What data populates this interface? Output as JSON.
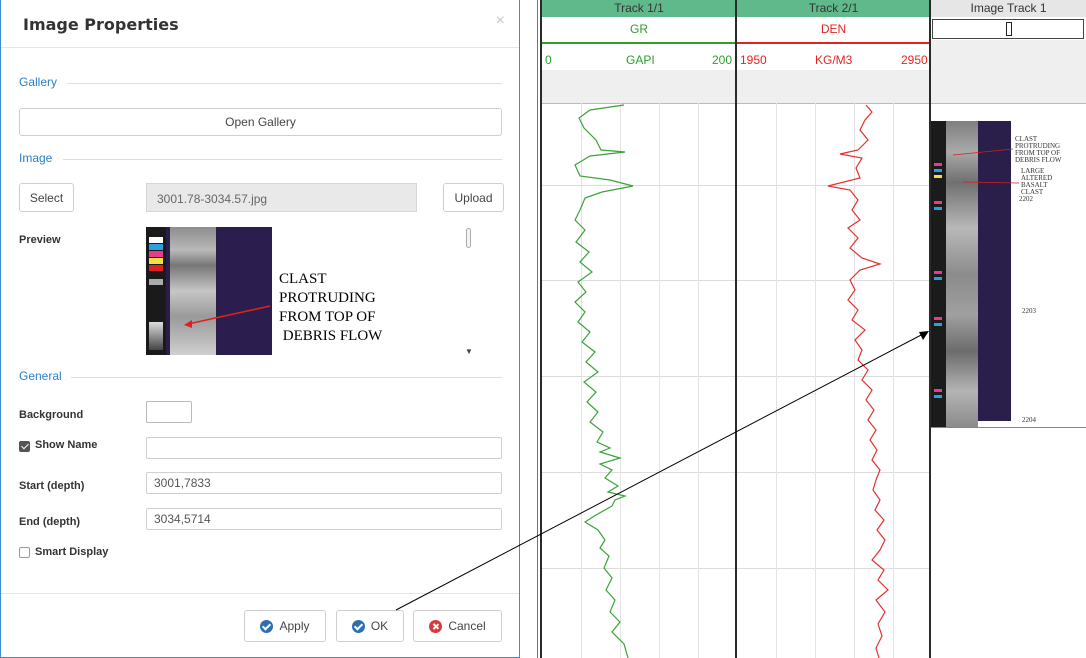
{
  "dialog": {
    "title": "Image Properties",
    "close_glyph": "×",
    "sections": {
      "gallery": "Gallery",
      "image": "Image",
      "general": "General"
    },
    "open_gallery_label": "Open Gallery",
    "select_label": "Select",
    "file_name": "3001.78-3034.57.jpg",
    "upload_label": "Upload",
    "preview_label": "Preview",
    "preview_caption": "CLAST\nPROTRUDING\nFROM TOP OF\n DEBRIS FLOW",
    "fields": {
      "background_label": "Background",
      "background_color": "#ffffff",
      "show_name_label": "Show Name",
      "show_name_checked": true,
      "show_name_value": "",
      "start_label": "Start (depth)",
      "start_value": "3001,7833",
      "end_label": "End (depth)",
      "end_value": "3034,5714",
      "smart_display_label": "Smart Display",
      "smart_display_checked": false
    },
    "buttons": {
      "apply": "Apply",
      "ok": "OK",
      "cancel": "Cancel"
    }
  },
  "log": {
    "tracks": [
      {
        "title": "Track 1/1",
        "curve": "GR",
        "min": "0",
        "unit": "GAPI",
        "max": "200",
        "color": "#2e9e2e"
      },
      {
        "title": "Track 2/1",
        "curve": "DEN",
        "min": "1950",
        "unit": "KG/M3",
        "max": "2950",
        "color": "#e02424"
      }
    ],
    "image_track": {
      "title": "Image Track 1",
      "annotation_top": "CLAST\nPROTRUDING\nFROM TOP OF\nDEBRIS FLOW",
      "annotation_mid": "LARGE\nALTERED\nBASALT\nCLAST",
      "depth_1": "2202",
      "depth_2": "2203",
      "depth_3": "2204"
    },
    "colors": {
      "track_header": "#5fb98a",
      "image_track_header": "#e6e6e6"
    }
  }
}
